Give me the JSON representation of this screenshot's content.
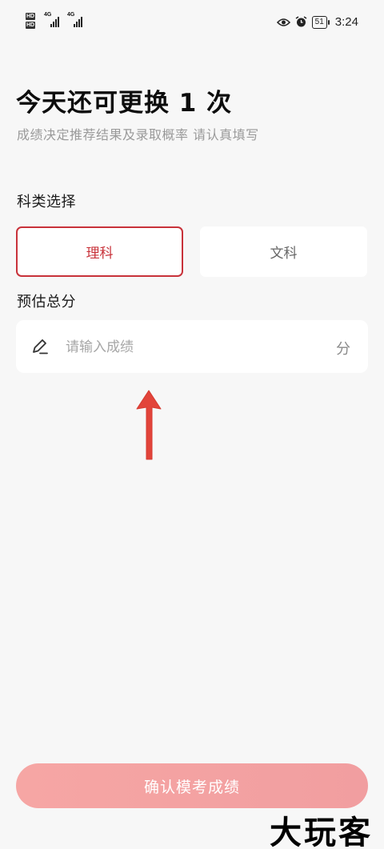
{
  "status_bar": {
    "sim1_label": "HD",
    "sim2_label": "HD",
    "net1": "4G",
    "net2": "4G",
    "battery": "51",
    "time": "3:24",
    "icons": [
      "eye-icon",
      "alarm-icon",
      "battery-icon"
    ]
  },
  "header": {
    "title": "今天还可更换 1 次",
    "subtitle": "成绩决定推荐结果及录取概率 请认真填写"
  },
  "subject": {
    "label": "科类选择",
    "options": [
      {
        "label": "理科",
        "selected": true
      },
      {
        "label": "文科",
        "selected": false
      }
    ]
  },
  "score": {
    "label": "预估总分",
    "value": "",
    "placeholder": "请输入成绩",
    "unit": "分"
  },
  "confirm_button": {
    "label": "确认模考成绩"
  },
  "watermark": "大玩客",
  "colors": {
    "accent": "#c8323a",
    "button": "#f3a2a2",
    "arrow": "#e2443a",
    "background": "#f7f7f7"
  }
}
